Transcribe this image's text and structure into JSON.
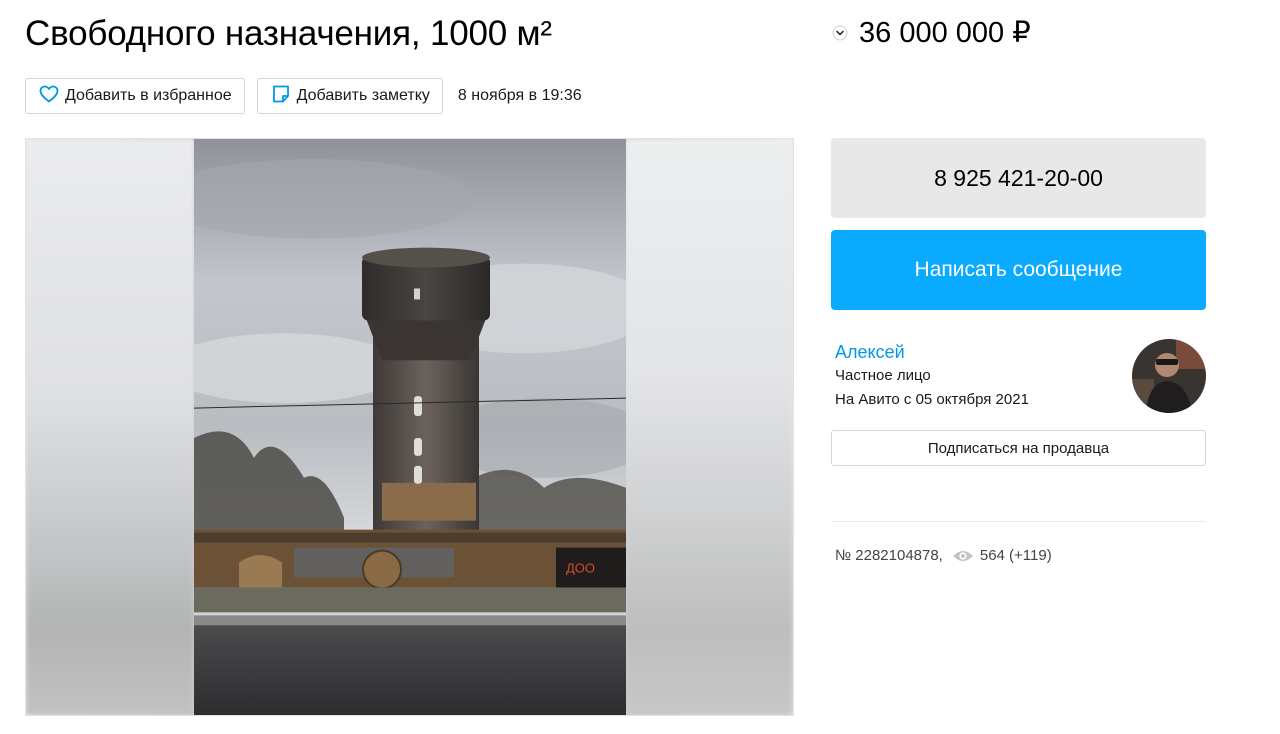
{
  "listing": {
    "title": "Свободного назначения, 1000 м²",
    "price": "36 000 000 ₽",
    "published": "8 ноября в 19:36",
    "id_text": "№ 2282104878,",
    "views": "564 (+119)"
  },
  "actions": {
    "favorite_label": "Добавить в избранное",
    "note_label": "Добавить заметку"
  },
  "contact": {
    "phone": "8 925 421-20-00",
    "message_label": "Написать сообщение"
  },
  "seller": {
    "name": "Алексей",
    "type": "Частное лицо",
    "since": "На Авито с 05 октября 2021",
    "subscribe_label": "Подписаться на продавца"
  },
  "colors": {
    "accent_blue": "#0aaaff",
    "link_blue": "#0099e6",
    "phone_bg": "#e8e8e8"
  },
  "icons": {
    "price_toggle": "chevron-down-icon",
    "favorite": "heart-icon",
    "note": "note-icon",
    "views": "eye-icon"
  }
}
